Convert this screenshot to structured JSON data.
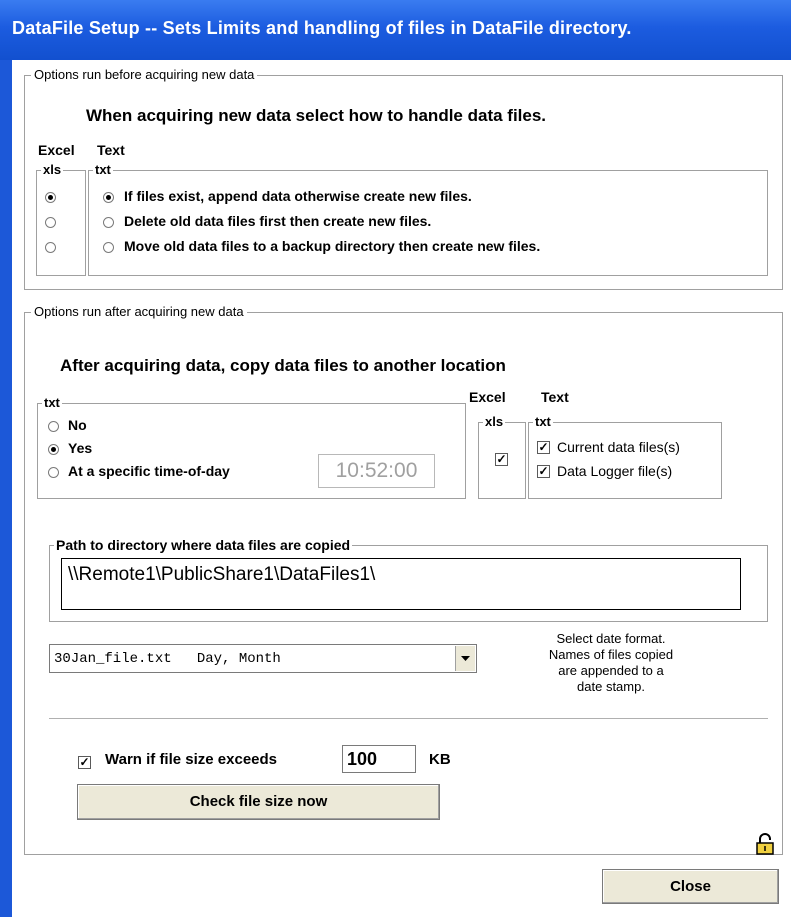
{
  "window": {
    "title": "DataFile Setup -- Sets Limits and handling of files in DataFile directory."
  },
  "before": {
    "legend": "Options run before acquiring new data",
    "heading": "When acquiring new data select how to handle data files.",
    "col_excel": "Excel",
    "col_text": "Text",
    "xls_label": "xls",
    "txt_label": "txt",
    "options": [
      {
        "label": "If files exist, append data otherwise create new files.",
        "xls_selected": true,
        "txt_selected": true
      },
      {
        "label": "Delete old data files first then create new files.",
        "xls_selected": false,
        "txt_selected": false
      },
      {
        "label": "Move old data files to a backup directory then create new files.",
        "xls_selected": false,
        "txt_selected": false
      }
    ]
  },
  "after": {
    "legend": "Options run after acquiring new data",
    "heading": "After acquiring data, copy data files to another location",
    "txt_group_label": "txt",
    "copy_options": [
      {
        "label": "No",
        "selected": false
      },
      {
        "label": "Yes",
        "selected": true
      },
      {
        "label": "At a specific time-of-day",
        "selected": false
      }
    ],
    "time_value": "10:52:00",
    "col_excel": "Excel",
    "col_text": "Text",
    "xls_label": "xls",
    "txt_label": "txt",
    "xls_checked": true,
    "text_checks": [
      {
        "label": "Current data files(s)",
        "checked": true
      },
      {
        "label": "Data Logger file(s)",
        "checked": true
      }
    ],
    "path_label": "Path to directory where data files are copied",
    "path_value": "\\\\Remote1\\PublicShare1\\DataFiles1\\",
    "date_format_selected": "30Jan_file.txt   Day, Month",
    "date_format_help": [
      "Select date format.",
      "Names of files copied",
      "are appended to a",
      "date stamp."
    ],
    "warn_label": "Warn if file size exceeds",
    "warn_checked": true,
    "warn_value": "100",
    "warn_unit": "KB",
    "check_button": "Check file size now"
  },
  "close_button": "Close"
}
